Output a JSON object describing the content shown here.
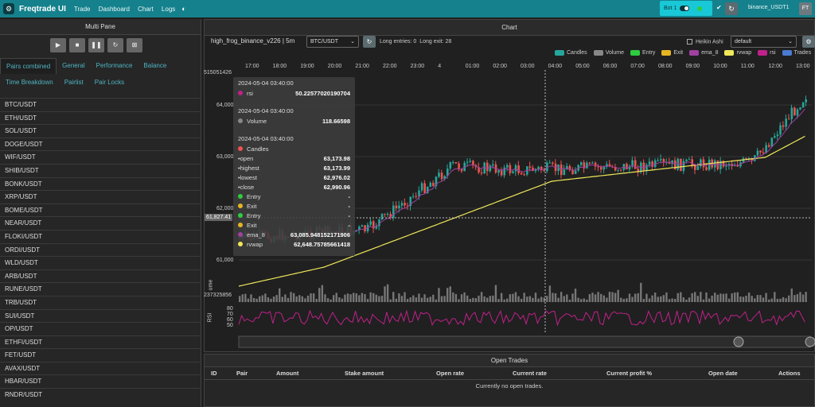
{
  "app": {
    "title": "Freqtrade UI",
    "nav": [
      "Trade",
      "Dashboard",
      "Chart",
      "Logs"
    ],
    "bot_label": "Bot 1",
    "account": "binance_USDT1",
    "avatar": "FT"
  },
  "left": {
    "title": "Multi Pane",
    "tabs_row1": [
      "Pairs combined",
      "General",
      "Performance",
      "Balance"
    ],
    "tabs_row2": [
      "Time Breakdown",
      "Pairlist",
      "Pair Locks"
    ],
    "pairs": [
      "BTC/USDT",
      "ETH/USDT",
      "SOL/USDT",
      "DOGE/USDT",
      "WIF/USDT",
      "SHIB/USDT",
      "BONK/USDT",
      "XRP/USDT",
      "BOME/USDT",
      "NEAR/USDT",
      "FLOKI/USDT",
      "ORDI/USDT",
      "WLD/USDT",
      "ARB/USDT",
      "RUNE/USDT",
      "TRB/USDT",
      "SUI/USDT",
      "OP/USDT",
      "ETHFI/USDT",
      "FET/USDT",
      "AVAX/USDT",
      "HBAR/USDT",
      "RNDR/USDT"
    ]
  },
  "chart": {
    "title": "Chart",
    "strategy": "high_frog_binance_v226 | 5m",
    "pair": "BTC/USDT",
    "entries": "Long entries: 0",
    "exits": "Long exit: 28",
    "heikin": "Heikin Ashi",
    "layout": "default",
    "legend": [
      {
        "label": "Candles",
        "color": "#26a69a"
      },
      {
        "label": "Volume",
        "color": "#888888"
      },
      {
        "label": "Entry",
        "color": "#2ecc40"
      },
      {
        "label": "Exit",
        "color": "#e6b422"
      },
      {
        "label": "ema_8",
        "color": "#a040a0"
      },
      {
        "label": "rvwap",
        "color": "#f0e85a"
      },
      {
        "label": "rsi",
        "color": "#c0208a"
      },
      {
        "label": "Trades",
        "color": "#4a7bd0"
      }
    ],
    "x_ticks": [
      "17:00",
      "18:00",
      "19:00",
      "20:00",
      "21:00",
      "22:00",
      "23:00",
      "4",
      "01:00",
      "02:00",
      "03:00",
      "04:00",
      "05:00",
      "06:00",
      "07:00",
      "08:00",
      "09:00",
      "10:00",
      "11:00",
      "12:00",
      "13:00"
    ],
    "y_ticks": [
      "64,000",
      "63,000",
      "62,000",
      "61,000"
    ],
    "y_top": "515051426",
    "crosshair_price": "61,827.41",
    "vol_label": "ume",
    "vol_val": "237325856",
    "rsi_label": "RSI",
    "rsi_ticks": [
      "80",
      "70",
      "60",
      "50"
    ],
    "tooltip": {
      "rsi": {
        "time": "2024-05-04 03:40:00",
        "label": "rsi",
        "value": "50.22577020190704"
      },
      "volume": {
        "time": "2024-05-04 03:40:00",
        "label": "Volume",
        "value": "118.66598"
      },
      "candles": {
        "time": "2024-05-04 03:40:00",
        "label": "Candles",
        "open": "63,173.98",
        "highest": "63,173.99",
        "lowest": "62,976.02",
        "close": "62,990.96"
      },
      "rows": [
        {
          "label": "Entry",
          "value": "-",
          "color": "#2ecc40"
        },
        {
          "label": "Exit",
          "value": "-",
          "color": "#e6b422"
        },
        {
          "label": "Entry",
          "value": "-",
          "color": "#2ecc40"
        },
        {
          "label": "Exit",
          "value": "-",
          "color": "#e6b422"
        },
        {
          "label": "ema_8",
          "value": "63,085.948152171906",
          "color": "#a040a0"
        },
        {
          "label": "rvwap",
          "value": "62,648.75785661418",
          "color": "#f0e85a"
        }
      ],
      "open_label": "open",
      "highest_label": "highest",
      "lowest_label": "lowest",
      "close_label": "close"
    }
  },
  "trades": {
    "title": "Open Trades",
    "columns": [
      "ID",
      "Pair",
      "Amount",
      "Stake amount",
      "Open rate",
      "Current rate",
      "Current profit %",
      "Open date",
      "Actions"
    ],
    "empty": "Currently no open trades."
  }
}
